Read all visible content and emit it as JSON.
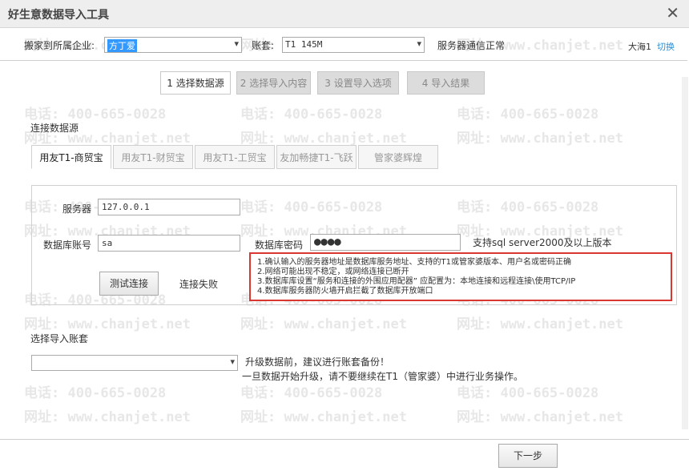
{
  "window": {
    "title": "好生意数据导入工具",
    "close_icon": "close-icon"
  },
  "topbar": {
    "company_label": "搬家到所属企业:",
    "company_value": "方丁爱",
    "account_label": "账套:",
    "account_value": "T1 145M",
    "server_status": "服务器通信正常",
    "user": "大海1",
    "switch_label": "切换"
  },
  "steps": [
    {
      "label": "1 选择数据源",
      "active": true
    },
    {
      "label": "2 选择导入内容",
      "active": false
    },
    {
      "label": "3 设置导入选项",
      "active": false
    },
    {
      "label": "4 导入结果",
      "active": false
    }
  ],
  "source": {
    "heading": "连接数据源",
    "tabs": [
      "用友T1-商贸宝",
      "用友T1-财贸宝",
      "用友T1-工贸宝",
      "友加畅捷T1-飞跃",
      "管家婆辉煌"
    ],
    "active_tab": 0
  },
  "form": {
    "server_label": "服务器",
    "server_value": "127.0.0.1",
    "db_account_label": "数据库账号",
    "db_account_value": "sa",
    "db_password_label": "数据库密码",
    "db_password_value": "●●●●",
    "support_note": "支持sql server2000及以上版本",
    "test_button": "测试连接",
    "test_result": "连接失败"
  },
  "errors": [
    "1.确认输入的服务器地址是数据库服务地址、支持的T1或管家婆版本、用户名或密码正确",
    "2.网络可能出现不稳定，或网络连接已断开",
    "3.数据库库设置“服务和连接的外围应用配器” 应配置为：本地连接和远程连接\\使用TCP/IP",
    "4.数据库服务器防火墙开启拦截了数据库开放端口"
  ],
  "import": {
    "heading": "选择导入账套",
    "select_value": "",
    "note1": "升级数据前，建议进行账套备份！",
    "note2": "一旦数据开始升级，请不要继续在T1（管家婆）中进行业务操作。"
  },
  "footer": {
    "next_button": "下一步"
  },
  "watermark": {
    "phone": "电话: 400-665-0028",
    "site": "网址: www.chanjet.net"
  }
}
